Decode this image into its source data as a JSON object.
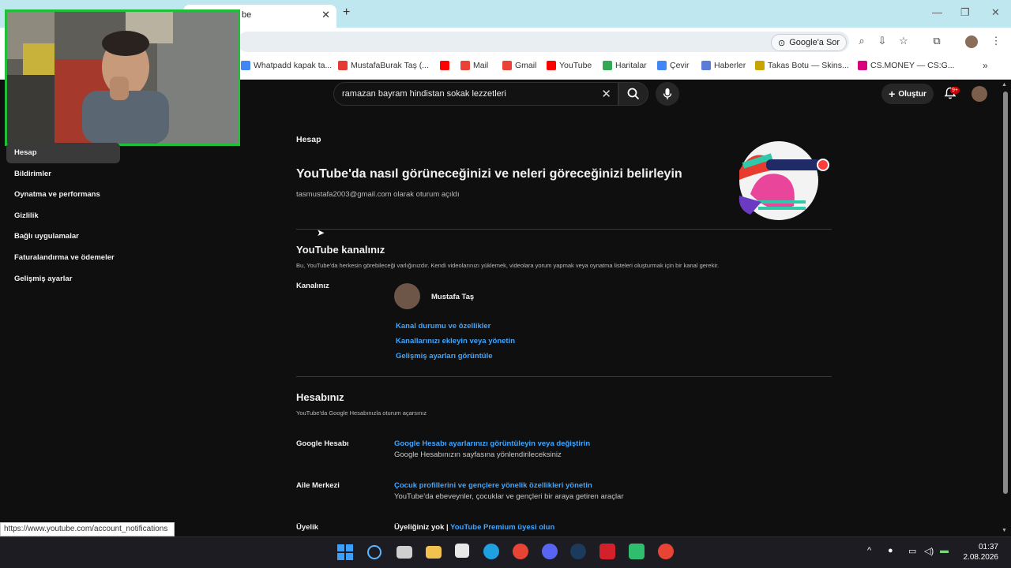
{
  "browser": {
    "tab_title": "be",
    "omni_google_sor": "Google'a Sor",
    "bookmarks": [
      {
        "label": "Whatpadd kapak ta...",
        "icon": "whatpadd-icon",
        "color": "#4285f4"
      },
      {
        "label": "MustafaBurak Taş (...",
        "icon": "aliexpress-icon",
        "color": "#e53935"
      },
      {
        "label": "",
        "icon": "youtube-icon",
        "color": "#ff0000"
      },
      {
        "label": "Mail",
        "icon": "gmail-icon",
        "color": "#ea4335"
      },
      {
        "label": "Gmail",
        "icon": "gmail-icon",
        "color": "#ea4335"
      },
      {
        "label": "YouTube",
        "icon": "youtube-icon",
        "color": "#ff0000"
      },
      {
        "label": "Haritalar",
        "icon": "maps-icon",
        "color": "#34a853"
      },
      {
        "label": "Çevir",
        "icon": "translate-icon",
        "color": "#4285f4"
      },
      {
        "label": "Haberler",
        "icon": "news-icon",
        "color": "#5a7bd6"
      },
      {
        "label": "Takas Botu — Skins...",
        "icon": "takas-icon",
        "color": "#c9a400"
      },
      {
        "label": "CS.MONEY — CS:G...",
        "icon": "csmoney-icon",
        "color": "#d9007e"
      }
    ],
    "status_url": "https://www.youtube.com/account_notifications"
  },
  "youtube": {
    "search_query": "ramazan bayram hindistan sokak lezzetleri",
    "create_label": "Oluştur",
    "notif_badge": "9+"
  },
  "sidebar": {
    "items": [
      {
        "label": "Hesap"
      },
      {
        "label": "Bildirimler"
      },
      {
        "label": "Oynatma ve performans"
      },
      {
        "label": "Gizlilik"
      },
      {
        "label": "Bağlı uygulamalar"
      },
      {
        "label": "Faturalandırma ve ödemeler"
      },
      {
        "label": "Gelişmiş ayarlar"
      }
    ]
  },
  "main": {
    "section_label": "Hesap",
    "headline": "YouTube'da nasıl görüneceğinizi ve neleri göreceğinizi belirleyin",
    "signed_in": "tasmustafa2003@gmail.com olarak oturum açıldı",
    "channel": {
      "title": "YouTube kanalınız",
      "desc": "Bu, YouTube'da herkesin görebileceği varlığınızdır. Kendi videolarınızı yüklemek, videolara yorum yapmak veya oynatma listeleri oluşturmak için bir kanal gerekir.",
      "label": "Kanalınız",
      "name": "Mustafa Taş",
      "links": [
        "Kanal durumu ve özellikler",
        "Kanallarınızı ekleyin veya yönetin",
        "Gelişmiş ayarları görüntüle"
      ]
    },
    "account": {
      "title": "Hesabınız",
      "desc": "YouTube'da Google Hesabınızla oturum açarsınız",
      "rows": [
        {
          "label": "Google Hesabı",
          "link": "Google Hesabı ayarlarınızı görüntüleyin veya değiştirin",
          "desc": "Google Hesabınızın sayfasına yönlendirileceksiniz"
        },
        {
          "label": "Aile Merkezi",
          "link": "Çocuk profillerini ve gençlere yönelik özellikleri yönetin",
          "desc": "YouTube'da ebeveynler, çocuklar ve gençleri bir araya getiren araçlar"
        },
        {
          "label": "Üyelik",
          "prefix": "Üyeliğiniz yok | ",
          "link": "YouTube Premium üyesi olun"
        }
      ]
    }
  },
  "taskbar": {
    "time": "01:37",
    "date": "2.08.2026"
  }
}
